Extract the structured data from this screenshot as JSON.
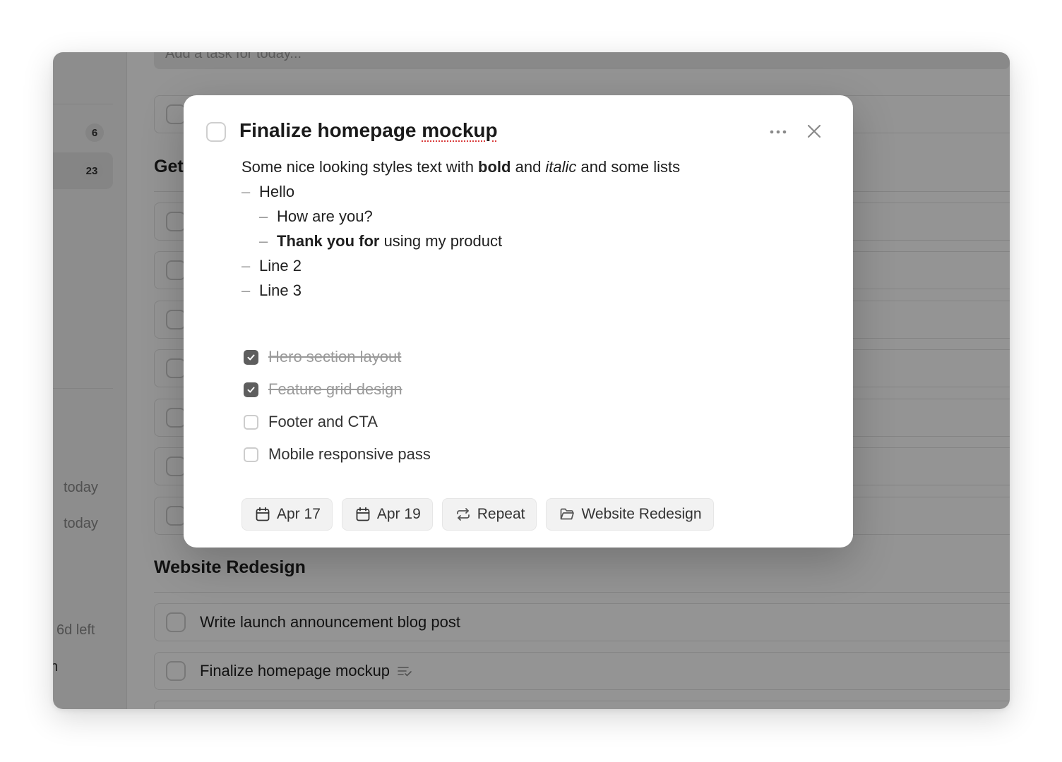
{
  "sidebar": {
    "counts": [
      "6",
      "23"
    ],
    "due_labels": [
      "today",
      "today"
    ],
    "time_left": "6d left",
    "cut_text": "n"
  },
  "main": {
    "add_task_placeholder": "Add a task for today...",
    "section_cut_title": "Get",
    "section_title": "Website Redesign",
    "tasks": [
      "Write launch announcement blog post",
      "Finalize homepage mockup"
    ]
  },
  "modal": {
    "title_part1": "Finalize homepage ",
    "title_part2": "mockup",
    "description": {
      "intro_plain1": "Some nice looking styles text with ",
      "intro_bold": "bold",
      "intro_plain2": " and ",
      "intro_italic": "italic",
      "intro_plain3": " and some lists",
      "item1": "Hello",
      "item1a": "How are you?",
      "item1b_bold": "Thank you for",
      "item1b_rest": " using my product",
      "item2": "Line 2",
      "item3": "Line 3",
      "dash": "–"
    },
    "checklist": [
      {
        "label": "Hero section layout",
        "checked": true
      },
      {
        "label": "Feature grid design",
        "checked": true
      },
      {
        "label": "Footer and CTA",
        "checked": false
      },
      {
        "label": "Mobile responsive pass",
        "checked": false
      }
    ],
    "chips": {
      "start_date": "Apr 17",
      "due_date": "Apr 19",
      "repeat": "Repeat",
      "project": "Website Redesign"
    },
    "icons": [
      "more-icon",
      "close-icon",
      "calendar-icon",
      "repeat-icon",
      "folder-icon",
      "check-icon",
      "notes-icon"
    ]
  }
}
